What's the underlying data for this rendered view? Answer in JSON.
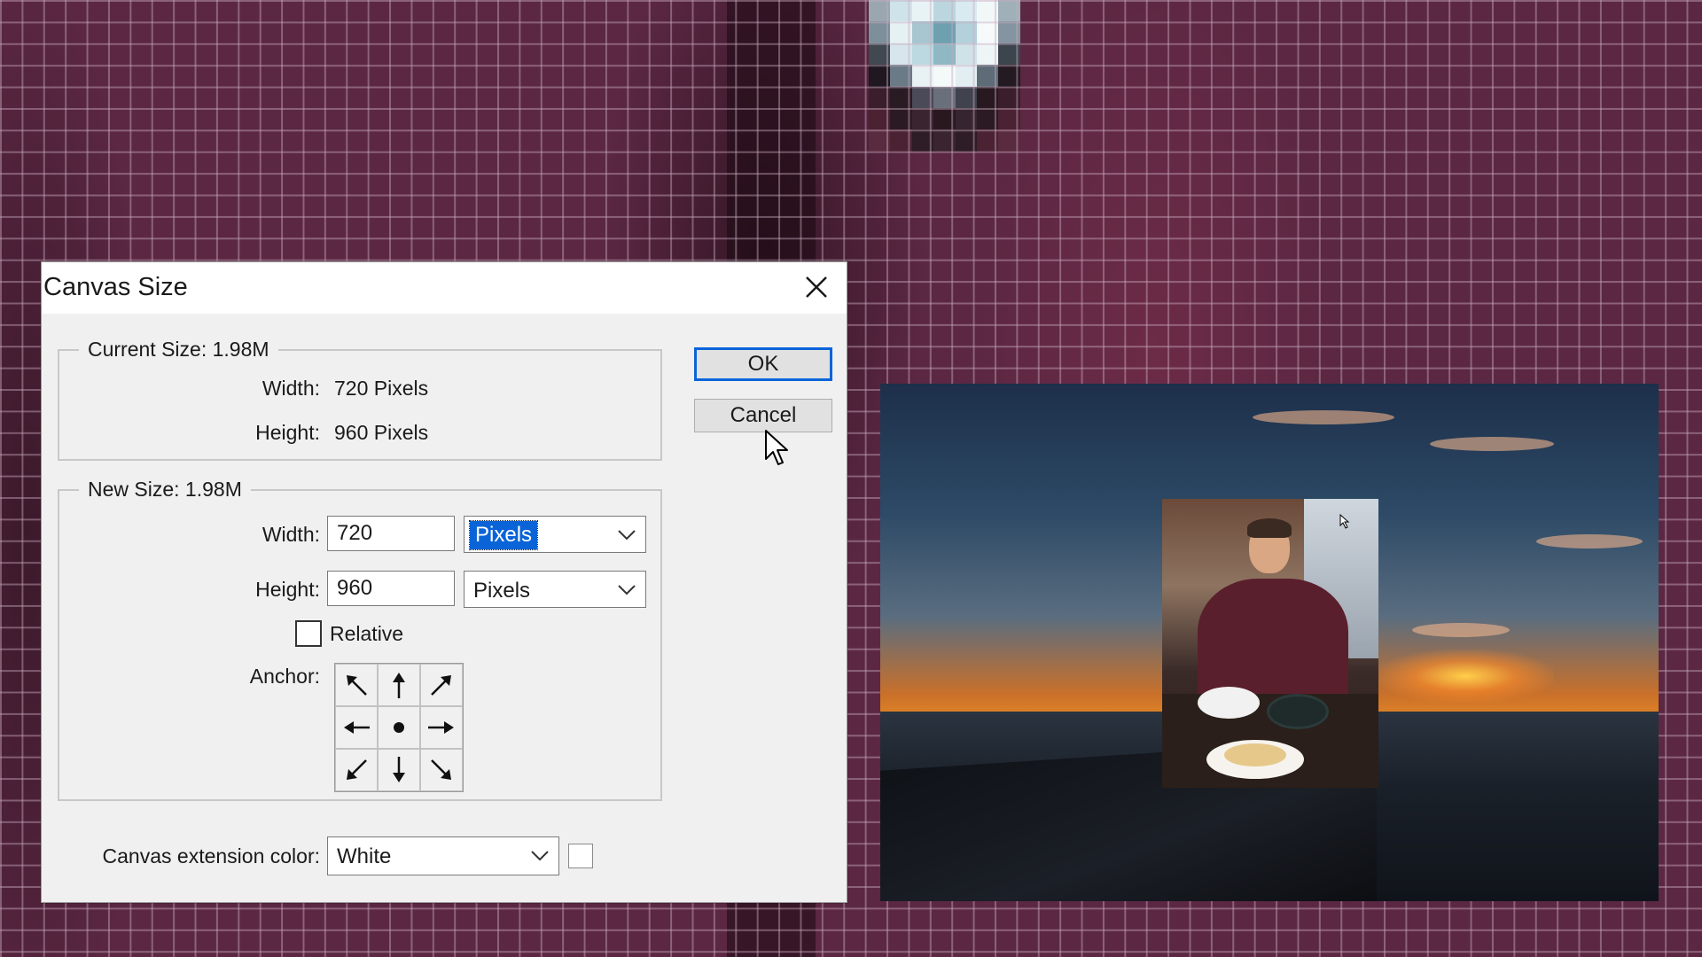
{
  "dialog": {
    "title": "Canvas Size",
    "current_size": {
      "label": "Current Size: 1.98M",
      "width_label": "Width:",
      "width_value": "720 Pixels",
      "height_label": "Height:",
      "height_value": "960 Pixels"
    },
    "new_size": {
      "label": "New Size: 1.98M",
      "width_label": "Width:",
      "width_value": "720",
      "width_unit": "Pixels",
      "height_label": "Height:",
      "height_value": "960",
      "height_unit": "Pixels",
      "relative_label": "Relative",
      "relative_checked": false,
      "anchor_label": "Anchor:",
      "anchor_cells": [
        "arrow-up-left-icon",
        "arrow-up-icon",
        "arrow-up-right-icon",
        "arrow-left-icon",
        "anchor-center-icon",
        "arrow-right-icon",
        "arrow-down-left-icon",
        "arrow-down-icon",
        "arrow-down-right-icon"
      ]
    },
    "extension": {
      "label": "Canvas extension color:",
      "value": "White",
      "swatch_color": "#ffffff"
    },
    "buttons": {
      "ok": "OK",
      "cancel": "Cancel"
    }
  },
  "colors": {
    "accent": "#0a64d8",
    "background": "#5b2742"
  }
}
